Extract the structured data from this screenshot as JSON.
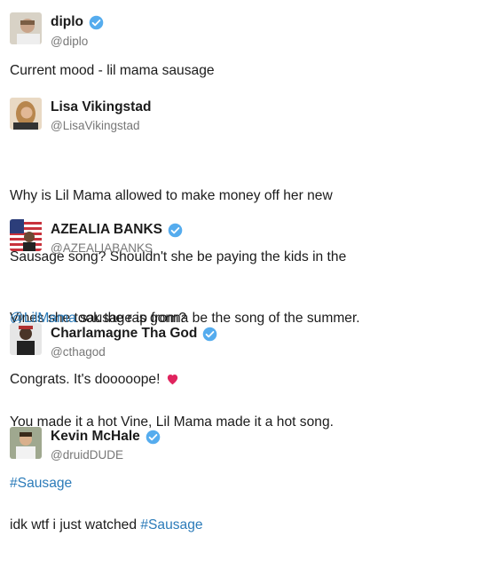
{
  "tweets": [
    {
      "name": "diplo",
      "handle": "@diplo",
      "verified": true,
      "text": "Current mood - lil mama sausage"
    },
    {
      "name": "Lisa Vikingstad",
      "handle": "@LisaVikingstad",
      "verified": false,
      "text_lines": [
        "Why is Lil Mama allowed to make money off her new",
        "Sausage song? Shouldn't she be paying the kids in the",
        "Vines she took the rap from?"
      ]
    },
    {
      "name": "AZEALIA BANKS",
      "handle": "@AZEALIABANKS",
      "verified": true,
      "mention": "@LilMama",
      "text_line1_rest": " sausage is gonna be the song of the summer.",
      "text_line2": "Congrats. It's dooooope!",
      "emoji": "heart-icon"
    },
    {
      "name": "Charlamagne Tha God",
      "handle": "@cthagod",
      "verified": true,
      "text_line1": "You made it a hot Vine, Lil Mama made it a hot song.",
      "hashtag": "#Sausage"
    },
    {
      "name": "Kevin McHale",
      "handle": "@druidDUDE",
      "verified": true,
      "text_prefix": "idk wtf i just watched ",
      "hashtag": "#Sausage"
    }
  ],
  "colors": {
    "link": "#2b7bb9",
    "verified": "#55acee",
    "handle": "#777777",
    "heart": "#e0245e"
  }
}
